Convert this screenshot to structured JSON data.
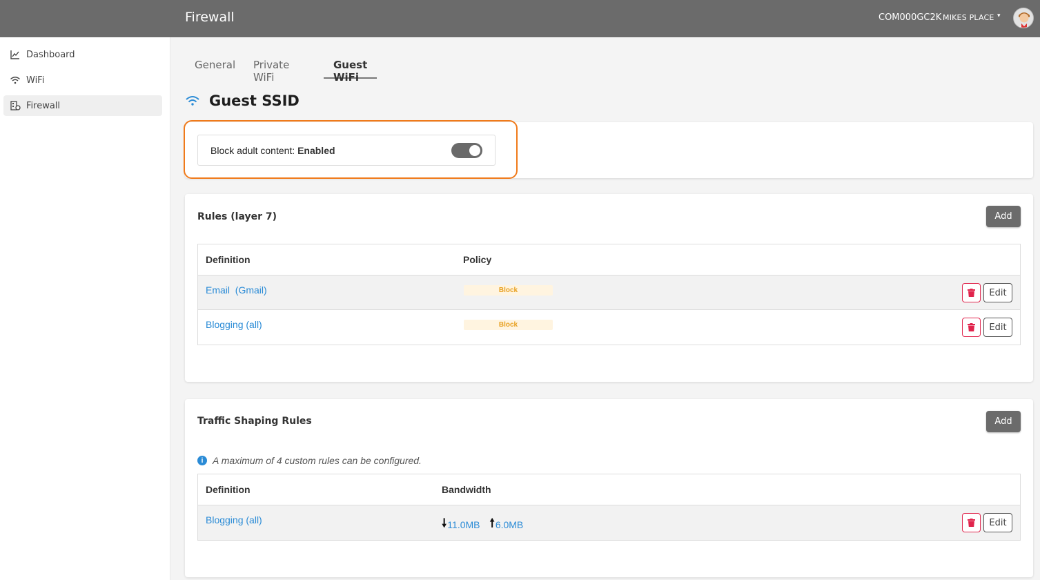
{
  "header": {
    "title": "Firewall",
    "device_id": "COM000GC2K",
    "place": "MIKES PLACE"
  },
  "sidebar": {
    "items": [
      {
        "label": "Dashboard",
        "icon": "chart-line-icon"
      },
      {
        "label": "WiFi",
        "icon": "wifi-icon"
      },
      {
        "label": "Firewall",
        "icon": "firewall-icon",
        "active": true
      }
    ]
  },
  "tabs": [
    {
      "label": "General"
    },
    {
      "label": "Private WiFi"
    },
    {
      "label": "Guest WiFi",
      "active": true
    }
  ],
  "ssid": {
    "title": "Guest SSID"
  },
  "adult_content": {
    "label": "Block adult content:",
    "status": "Enabled",
    "enabled": true
  },
  "rules_l7": {
    "title": "Rules (layer 7)",
    "add_label": "Add",
    "columns": [
      "Definition",
      "Policy"
    ],
    "rows": [
      {
        "definition": "Email  (Gmail)",
        "policy": "Block",
        "edit_label": "Edit"
      },
      {
        "definition": "Blogging (all)",
        "policy": "Block",
        "edit_label": "Edit"
      }
    ]
  },
  "traffic_shaping": {
    "title": "Traffic Shaping Rules",
    "add_label": "Add",
    "info": "A maximum of 4 custom rules can be configured.",
    "columns": [
      "Definition",
      "Bandwidth"
    ],
    "rows": [
      {
        "definition": "Blogging (all)",
        "down": "11.0MB",
        "up": "6.0MB",
        "edit_label": "Edit"
      }
    ]
  },
  "colors": {
    "header_bg": "#6b6b6b",
    "accent_link": "#2a8bd6",
    "highlight": "#f07a1a",
    "danger": "#e0244c",
    "block_badge_text": "#e8a020"
  }
}
